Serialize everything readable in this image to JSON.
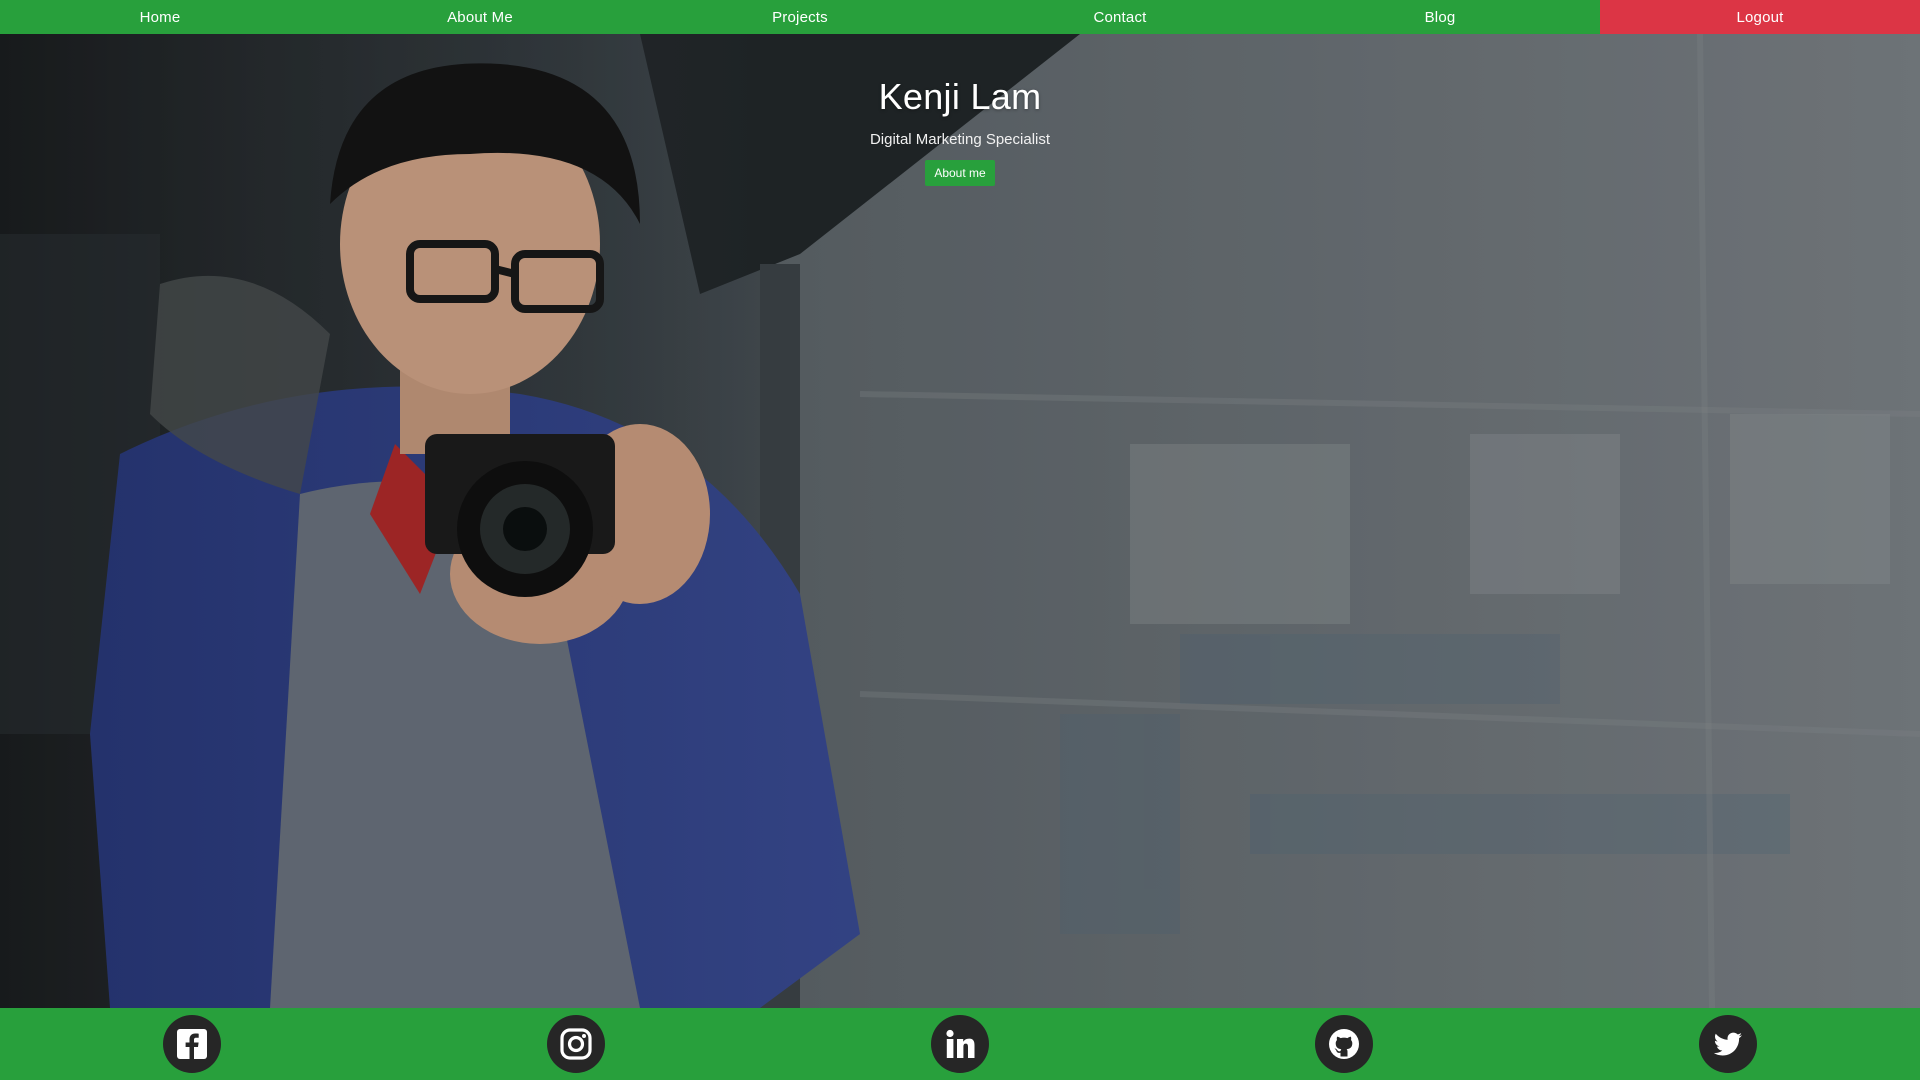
{
  "nav": {
    "items": [
      {
        "label": "Home"
      },
      {
        "label": "About Me"
      },
      {
        "label": "Projects"
      },
      {
        "label": "Contact"
      },
      {
        "label": "Blog"
      }
    ],
    "logout_label": "Logout"
  },
  "hero": {
    "name": "Kenji Lam",
    "subtitle": "Digital Marketing Specialist",
    "button_label": "About me",
    "background_image": "portrait-with-camera"
  },
  "social": {
    "links": [
      {
        "icon": "facebook-icon"
      },
      {
        "icon": "instagram-icon"
      },
      {
        "icon": "linkedin-icon"
      },
      {
        "icon": "github-icon"
      },
      {
        "icon": "twitter-icon"
      }
    ]
  },
  "colors": {
    "primary_green": "#28a03c",
    "logout_red": "#dc3545",
    "icon_circle": "#262626"
  }
}
